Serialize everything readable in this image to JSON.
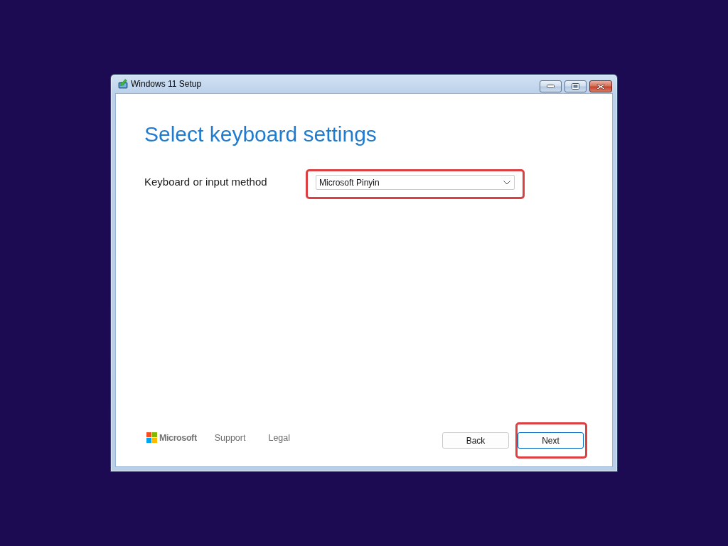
{
  "window": {
    "title": "Windows 11 Setup"
  },
  "page": {
    "heading": "Select keyboard settings"
  },
  "keyboard_field": {
    "label": "Keyboard or input method",
    "value": "Microsoft Pinyin",
    "highlighted": true
  },
  "footer": {
    "brand": "Microsoft",
    "links": [
      "Support",
      "Legal"
    ]
  },
  "buttons": [
    {
      "label": "Back",
      "focused": false,
      "highlighted": false
    },
    {
      "label": "Next",
      "focused": true,
      "highlighted": true
    }
  ]
}
